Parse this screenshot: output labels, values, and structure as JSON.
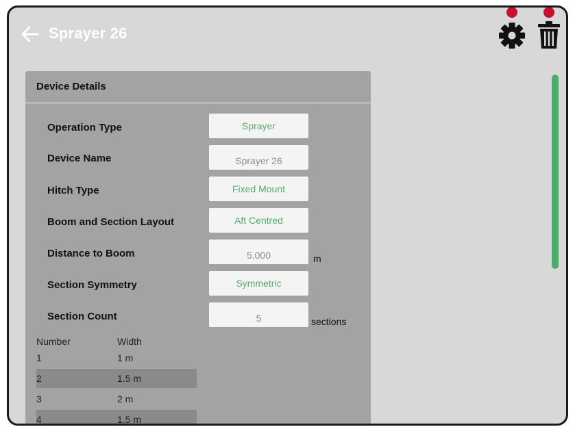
{
  "header": {
    "title": "Sprayer 26"
  },
  "panel": {
    "title": "Device Details",
    "fields": [
      {
        "label": "Operation Type",
        "value": "Sprayer",
        "kind": "select",
        "unit": ""
      },
      {
        "label": "Device Name",
        "value": "Sprayer 26",
        "kind": "input",
        "unit": ""
      },
      {
        "label": "Hitch Type",
        "value": "Fixed Mount",
        "kind": "select",
        "unit": ""
      },
      {
        "label": "Boom and Section Layout",
        "value": "Aft Centred",
        "kind": "select",
        "unit": ""
      },
      {
        "label": "Distance to Boom",
        "value": "5.000",
        "kind": "input",
        "unit": "m"
      },
      {
        "label": "Section Symmetry",
        "value": "Symmetric",
        "kind": "select",
        "unit": ""
      },
      {
        "label": "Section Count",
        "value": "5",
        "kind": "input",
        "unit": "sections"
      }
    ],
    "table": {
      "headers": {
        "number": "Number",
        "width": "Width"
      },
      "rows": [
        {
          "number": "1",
          "width": "1 m"
        },
        {
          "number": "2",
          "width": "1.5 m"
        },
        {
          "number": "3",
          "width": "2 m"
        },
        {
          "number": "4",
          "width": "1.5 m"
        }
      ]
    }
  },
  "colors": {
    "background": "#d8d8d8",
    "panel": "#a3a3a3",
    "accent_green": "#4cad6b",
    "select_text": "#5aaa6e",
    "callout_red": "#c8102e"
  },
  "icons": {
    "back": "arrow-left-icon",
    "settings": "gear-icon",
    "delete": "trash-icon"
  }
}
